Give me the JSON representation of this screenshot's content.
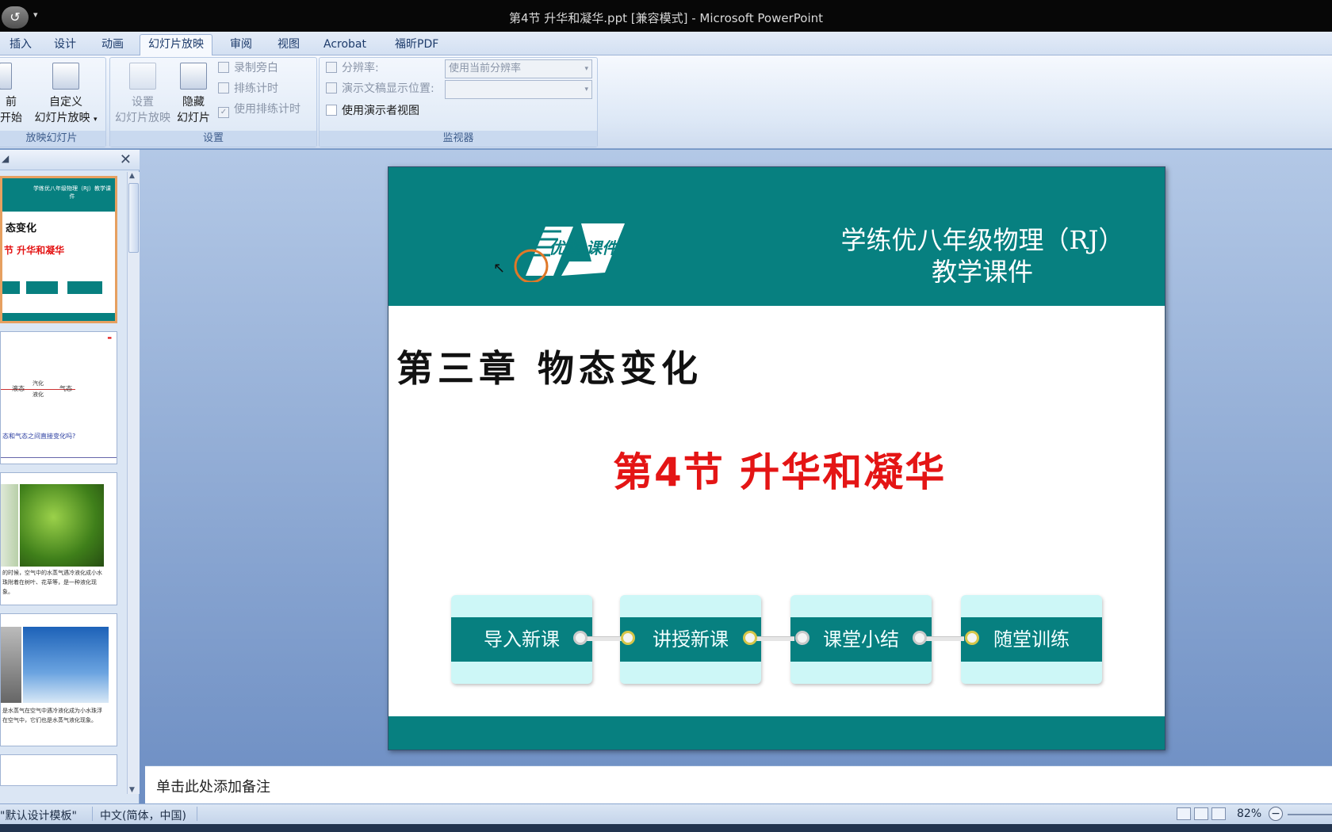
{
  "titlebar": {
    "title": "第4节  升华和凝华.ppt [兼容模式] - Microsoft PowerPoint",
    "office_button_icon": "undo-icon",
    "quick_access_dropdown": "▾"
  },
  "ribbon_tabs": [
    {
      "label": "插入"
    },
    {
      "label": "设计"
    },
    {
      "label": "动画"
    },
    {
      "label": "幻灯片放映",
      "active": true
    },
    {
      "label": "审阅"
    },
    {
      "label": "视图"
    },
    {
      "label": "Acrobat"
    },
    {
      "label": "福昕PDF"
    }
  ],
  "ribbon": {
    "start_group": {
      "label": "放映幻灯片",
      "from_current_line1": "前",
      "from_current_line2": "开始",
      "custom_line1": "自定义",
      "custom_line2": "幻灯片放映"
    },
    "setup_group": {
      "label": "设置",
      "setup_line1": "设置",
      "setup_line2": "幻灯片放映",
      "hide_line1": "隐藏",
      "hide_line2": "幻灯片",
      "record_narration": "录制旁白",
      "rehearse_timings": "排练计时",
      "use_rehearsed_timings": "使用排练计时"
    },
    "monitors_group": {
      "label": "监视器",
      "resolution_label": "分辨率:",
      "resolution_value": "使用当前分辨率",
      "show_on_label": "演示文稿显示位置:",
      "show_on_value": "",
      "presenter_view": "使用演示者视图"
    }
  },
  "slide": {
    "header_line1": "学练优八年级物理（RJ）",
    "header_line2": "教学课件",
    "logo_text": "优翼 课件",
    "chapter": "第三章   物态变化",
    "section": "第4节  升华和凝华",
    "nav_buttons": [
      "导入新课",
      "讲授新课",
      "课堂小结",
      "随堂训练"
    ]
  },
  "thumbnails": {
    "t1_title": "学练优八年级物理（RJ）教学课件",
    "t1_line1": "态变化",
    "t1_line2": "节  升华和凝华",
    "t2_text": "态和气态之间直接变化吗?",
    "t3_text": "的时候，空气中的水蒸气遇冷液化成小水珠附着在树叶、花草等，是一种液化现象。",
    "t4_text": "是水蒸气在空气中遇冷液化成为小水珠浮在空气中，它们也是水蒸气液化现象。"
  },
  "notes": {
    "placeholder": "单击此处添加备注"
  },
  "status": {
    "template": "\"默认设计模板\"",
    "language": "中文(简体，中国)",
    "zoom": "82%"
  },
  "colors": {
    "teal": "#078080",
    "section_red": "#e41515",
    "nav_light": "#cdf7f7"
  }
}
